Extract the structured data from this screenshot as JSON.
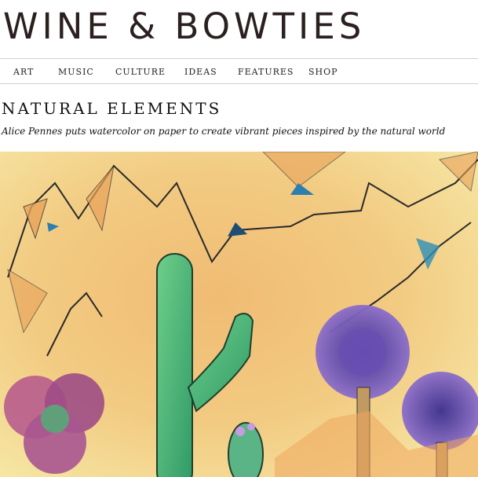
{
  "site": {
    "logo": "WINE & BOWTIES"
  },
  "nav": {
    "items": [
      "ART",
      "MUSIC",
      "CULTURE",
      "IDEAS",
      "FEATURES",
      "SHOP"
    ]
  },
  "article": {
    "title": "NATURAL ELEMENTS",
    "subtitle": "Alice Pennes puts watercolor on paper to create vibrant pieces inspired by the natural world"
  },
  "colors": {
    "background_yellow": "#f4d98a",
    "orange_wash": "#eeb46a",
    "cactus_green": "#3fae6b",
    "purple_flower": "#7a57b8",
    "teal_triangle": "#2b7fb0"
  }
}
